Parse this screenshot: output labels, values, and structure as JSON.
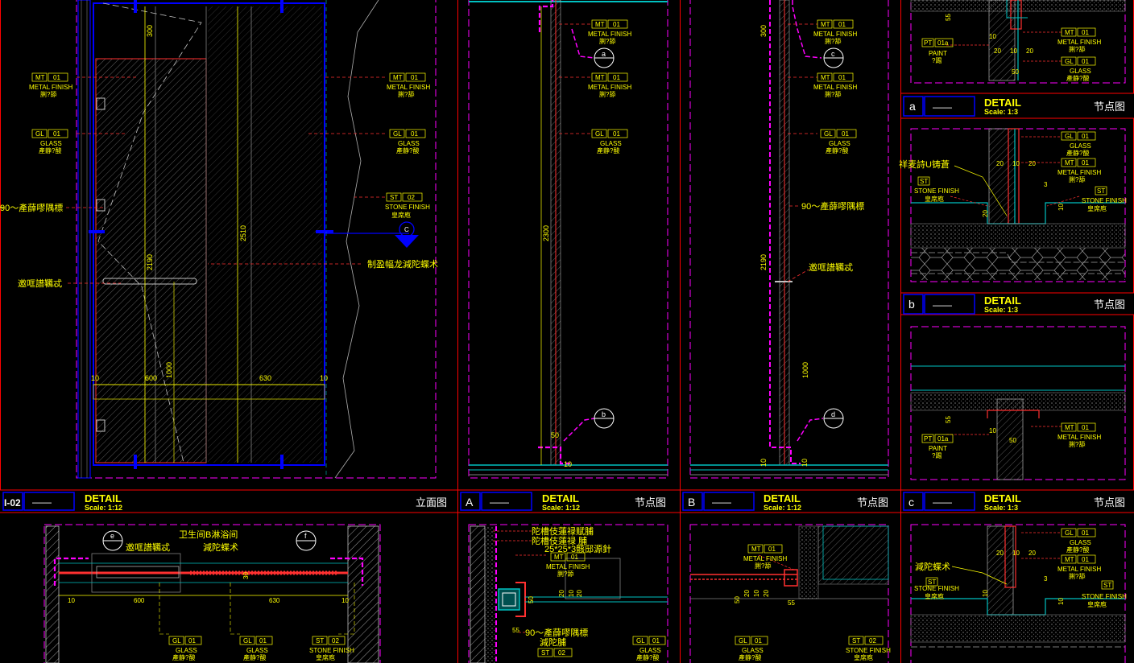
{
  "colors": {
    "frame": "#ff0000",
    "magenta": "#ff00ff",
    "cyan": "#00ffff",
    "yellow": "#ffff00",
    "blue": "#0000ff",
    "white": "#ffffff",
    "green": "#00c000",
    "grey": "#808080",
    "orange": "#ff7f00"
  },
  "title_blocks": {
    "elev": {
      "code": "I-02",
      "line": "——",
      "title": "DETAIL",
      "scale": "Scale: 1:12",
      "name": "立面图"
    },
    "A": {
      "code": "A",
      "line": "——",
      "title": "DETAIL",
      "scale": "Scale: 1:12",
      "name": "节点图"
    },
    "B": {
      "code": "B",
      "line": "——",
      "title": "DETAIL",
      "scale": "Scale: 1:12",
      "name": "节点图"
    },
    "c": {
      "code": "c",
      "line": "——",
      "title": "DETAIL",
      "scale": "Scale: 1:3",
      "name": "节点图"
    },
    "a": {
      "code": "a",
      "line": "——",
      "title": "DETAIL",
      "scale": "Scale: 1:3",
      "name": "节点图"
    },
    "b": {
      "code": "b",
      "line": "——",
      "title": "DETAIL",
      "scale": "Scale: 1:3",
      "name": "节点图"
    }
  },
  "tags": {
    "mt": {
      "code": "MT",
      "num": "01",
      "label": "METAL FINISH",
      "sub": "脷?舔"
    },
    "gl": {
      "code": "GL",
      "num": "01",
      "label": "GLASS",
      "sub": "產静?酸"
    },
    "st": {
      "code": "ST",
      "num": "02",
      "label": "STONE FINISH",
      "sub": "皇席庖"
    },
    "pt": {
      "code": "PT",
      "num": "01a",
      "label": "PAINT",
      "sub": "?踢"
    }
  },
  "sections": {
    "c": "C",
    "a": "a",
    "b": "b",
    "c2": "c",
    "d": "d",
    "e": "e",
    "f": "f"
  },
  "notes": {
    "n90": "90～產薛嘐隅標",
    "handle": "邀哐譜韉忒",
    "frame": "制盈幅龙減陀蝶术",
    "mirror": "90～產薛嘐隅標",
    "tape": "祥麦詩U铸蒼",
    "reduce": "減陀蝶术",
    "room": "卫生间B淋浴间",
    "hinge": "減陀蝶术",
    "frameA1": "陀槽伎蓮禄赋脯",
    "frameA2": "陀槽伎蓮禄  脯",
    "pipe": "25*25*3骸邸源針",
    "reduceA": "減陀脯"
  },
  "dimensions": {
    "d300": "300",
    "d2190": "2190",
    "d2510": "2510",
    "d1000": "1000",
    "d600": "600",
    "d630": "630",
    "d10": "10",
    "d2300": "2300",
    "d50": "50",
    "d20": "20",
    "d55": "55",
    "d5": "5",
    "d3": "3",
    "d30": "30"
  }
}
